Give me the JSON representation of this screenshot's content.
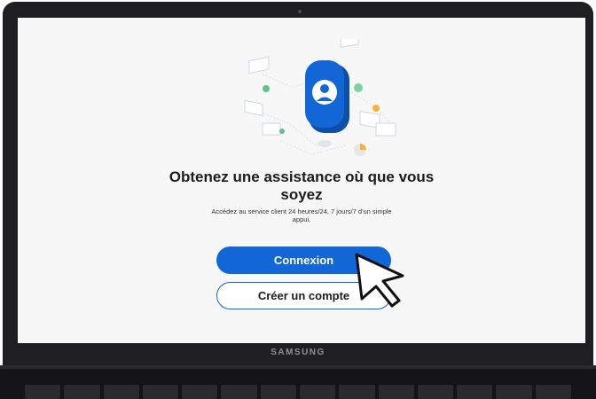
{
  "screen": {
    "headline": "Obtenez une assistance où que vous soyez",
    "subtext": "Accédez au service client 24 heures/24, 7 jours/7 d'un simple appui.",
    "primary_button": "Connexion",
    "secondary_button": "Créer un compte"
  },
  "device": {
    "brand": "SAMSUNG"
  },
  "colors": {
    "accent": "#1366d6",
    "screen_background": "#f7f7f7",
    "bezel": "#1f1f22"
  },
  "icons": [
    "user-account-icon",
    "mouse-pointer-icon",
    "camera-icon"
  ]
}
